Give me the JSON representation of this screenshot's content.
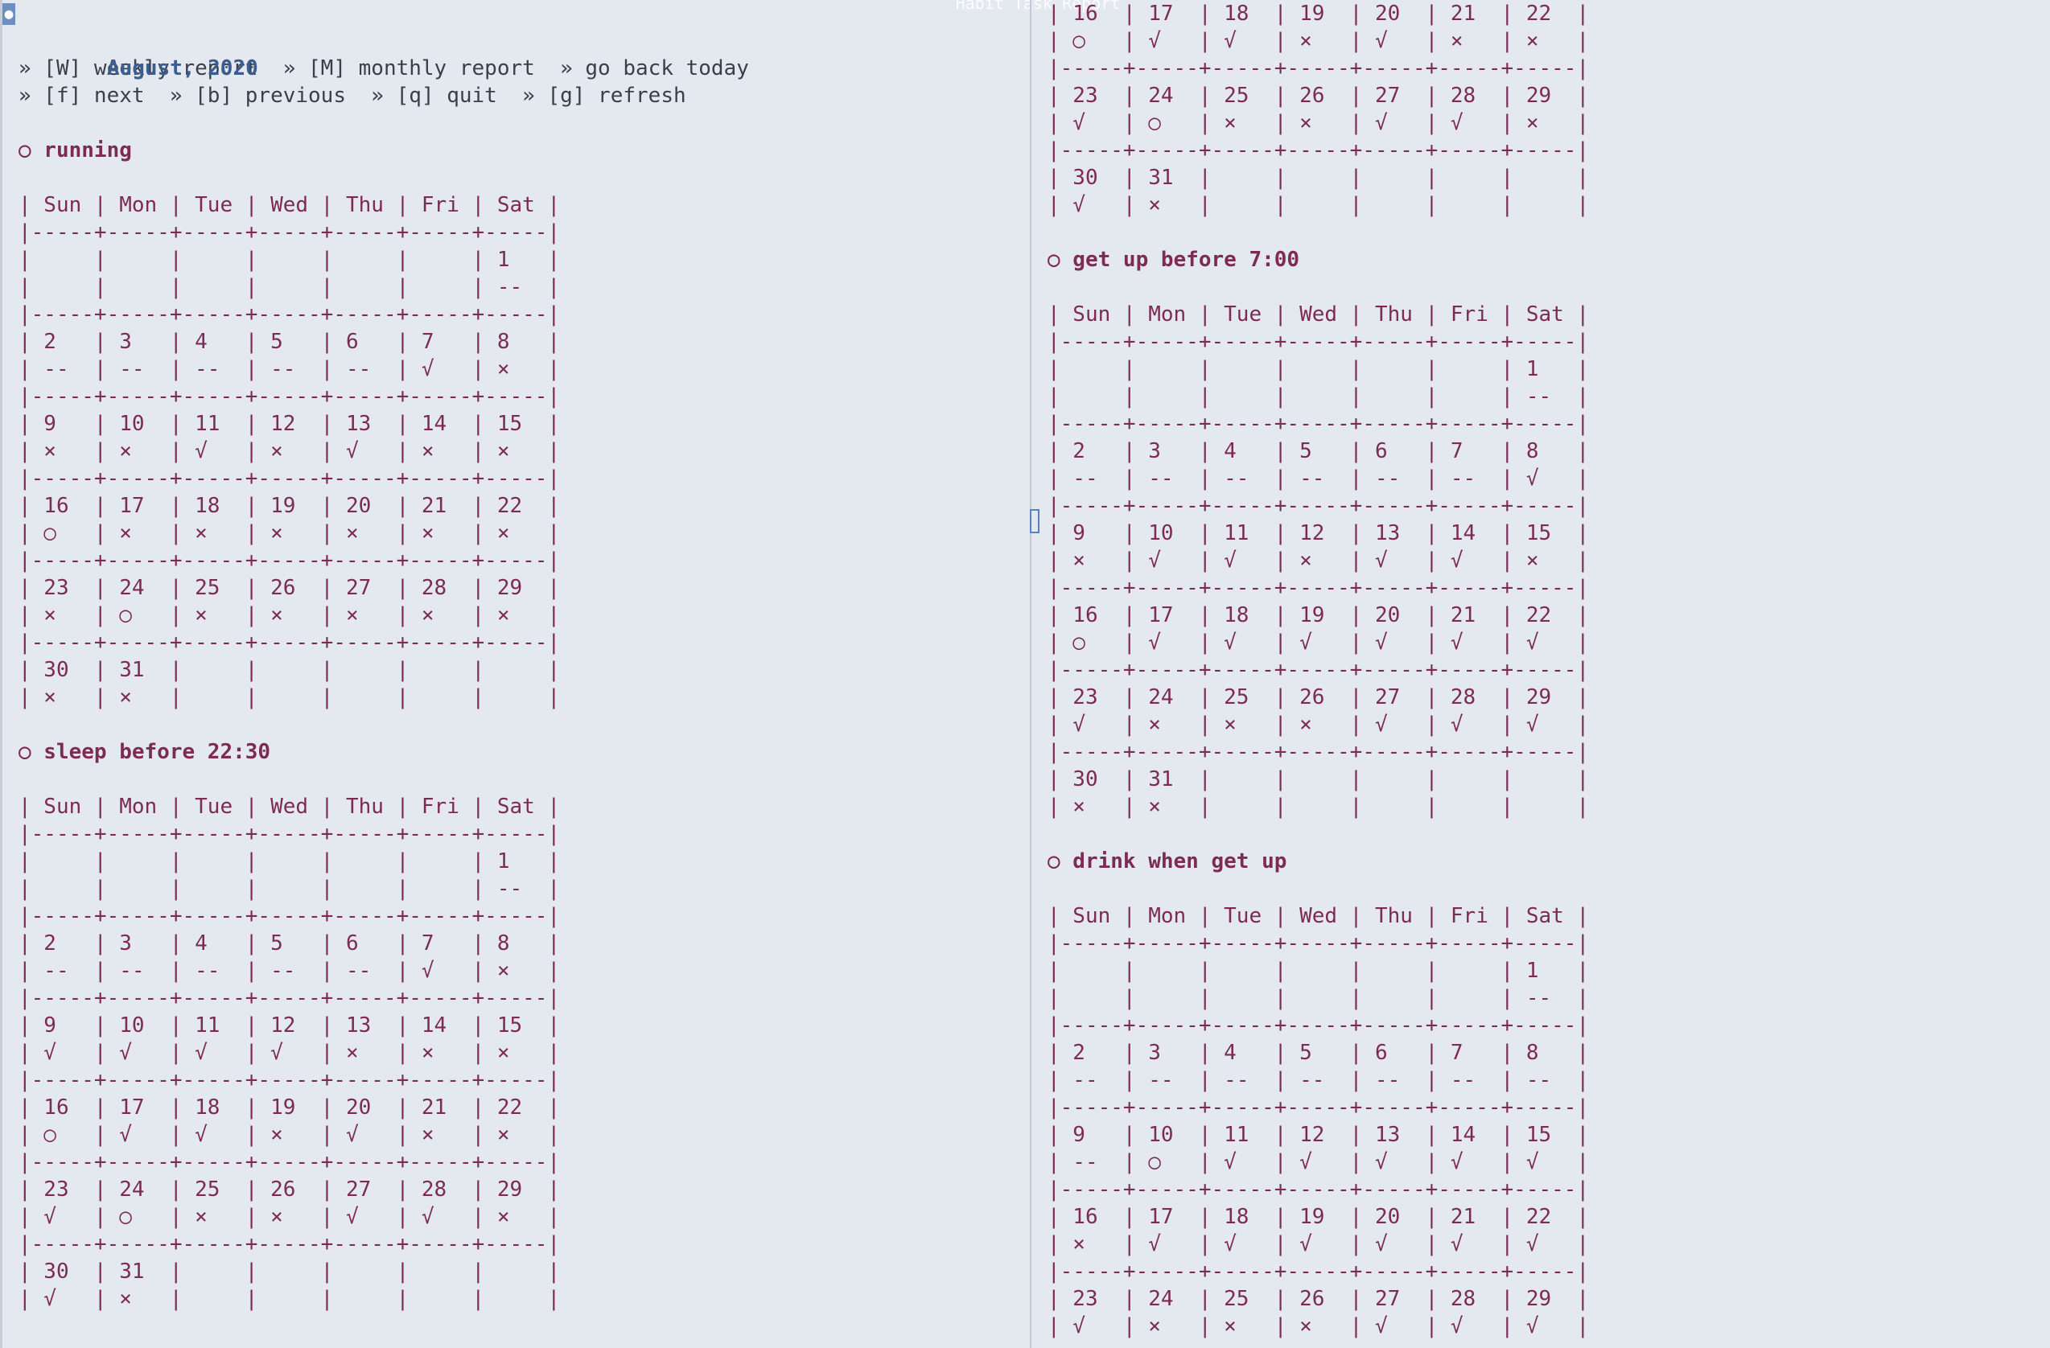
{
  "window_title": "Habit Task Report",
  "header": {
    "title": "August, 2020",
    "menu_line_1": "» [W] weekly report  » [M] monthly report  » go back today",
    "menu_line_2": "» [f] next  » [b] previous  » [q] quit  » [g] refresh"
  },
  "weekdays": [
    "Sun",
    "Mon",
    "Tue",
    "Wed",
    "Thu",
    "Fri",
    "Sat"
  ],
  "habits": [
    {
      "name": "○ running",
      "weeks": [
        [
          [
            "",
            ""
          ],
          [
            "",
            ""
          ],
          [
            "",
            ""
          ],
          [
            "",
            ""
          ],
          [
            "",
            ""
          ],
          [
            "",
            ""
          ],
          [
            "1",
            "--"
          ]
        ],
        [
          [
            "2",
            "--"
          ],
          [
            "3",
            "--"
          ],
          [
            "4",
            "--"
          ],
          [
            "5",
            "--"
          ],
          [
            "6",
            "--"
          ],
          [
            "7",
            "√"
          ],
          [
            "8",
            "×"
          ]
        ],
        [
          [
            "9",
            "×"
          ],
          [
            "10",
            "×"
          ],
          [
            "11",
            "√"
          ],
          [
            "12",
            "×"
          ],
          [
            "13",
            "√"
          ],
          [
            "14",
            "×"
          ],
          [
            "15",
            "×"
          ]
        ],
        [
          [
            "16",
            "○"
          ],
          [
            "17",
            "×"
          ],
          [
            "18",
            "×"
          ],
          [
            "19",
            "×"
          ],
          [
            "20",
            "×"
          ],
          [
            "21",
            "×"
          ],
          [
            "22",
            "×"
          ]
        ],
        [
          [
            "23",
            "×"
          ],
          [
            "24",
            "○"
          ],
          [
            "25",
            "×"
          ],
          [
            "26",
            "×"
          ],
          [
            "27",
            "×"
          ],
          [
            "28",
            "×"
          ],
          [
            "29",
            "×"
          ]
        ],
        [
          [
            "30",
            "×"
          ],
          [
            "31",
            "×"
          ],
          [
            "",
            ""
          ],
          [
            "",
            ""
          ],
          [
            "",
            ""
          ],
          [
            "",
            ""
          ],
          [
            "",
            ""
          ]
        ]
      ]
    },
    {
      "name": "○ sleep before 22:30",
      "weeks": [
        [
          [
            "",
            ""
          ],
          [
            "",
            ""
          ],
          [
            "",
            ""
          ],
          [
            "",
            ""
          ],
          [
            "",
            ""
          ],
          [
            "",
            ""
          ],
          [
            "1",
            "--"
          ]
        ],
        [
          [
            "2",
            "--"
          ],
          [
            "3",
            "--"
          ],
          [
            "4",
            "--"
          ],
          [
            "5",
            "--"
          ],
          [
            "6",
            "--"
          ],
          [
            "7",
            "√"
          ],
          [
            "8",
            "×"
          ]
        ],
        [
          [
            "9",
            "√"
          ],
          [
            "10",
            "√"
          ],
          [
            "11",
            "√"
          ],
          [
            "12",
            "√"
          ],
          [
            "13",
            "×"
          ],
          [
            "14",
            "×"
          ],
          [
            "15",
            "×"
          ]
        ],
        [
          [
            "16",
            "○"
          ],
          [
            "17",
            "√"
          ],
          [
            "18",
            "√"
          ],
          [
            "19",
            "×"
          ],
          [
            "20",
            "√"
          ],
          [
            "21",
            "×"
          ],
          [
            "22",
            "×"
          ]
        ],
        [
          [
            "23",
            "√"
          ],
          [
            "24",
            "○"
          ],
          [
            "25",
            "×"
          ],
          [
            "26",
            "×"
          ],
          [
            "27",
            "√"
          ],
          [
            "28",
            "√"
          ],
          [
            "29",
            "×"
          ]
        ],
        [
          [
            "30",
            "√"
          ],
          [
            "31",
            "×"
          ],
          [
            "",
            ""
          ],
          [
            "",
            ""
          ],
          [
            "",
            ""
          ],
          [
            "",
            ""
          ],
          [
            "",
            ""
          ]
        ]
      ]
    },
    {
      "name": "○ get up before 7:00",
      "weeks": [
        [
          [
            "",
            ""
          ],
          [
            "",
            ""
          ],
          [
            "",
            ""
          ],
          [
            "",
            ""
          ],
          [
            "",
            ""
          ],
          [
            "",
            ""
          ],
          [
            "1",
            "--"
          ]
        ],
        [
          [
            "2",
            "--"
          ],
          [
            "3",
            "--"
          ],
          [
            "4",
            "--"
          ],
          [
            "5",
            "--"
          ],
          [
            "6",
            "--"
          ],
          [
            "7",
            "--"
          ],
          [
            "8",
            "√"
          ]
        ],
        [
          [
            "9",
            "×"
          ],
          [
            "10",
            "√"
          ],
          [
            "11",
            "√"
          ],
          [
            "12",
            "×"
          ],
          [
            "13",
            "√"
          ],
          [
            "14",
            "√"
          ],
          [
            "15",
            "×"
          ]
        ],
        [
          [
            "16",
            "○"
          ],
          [
            "17",
            "√"
          ],
          [
            "18",
            "√"
          ],
          [
            "19",
            "√"
          ],
          [
            "20",
            "√"
          ],
          [
            "21",
            "√"
          ],
          [
            "22",
            "√"
          ]
        ],
        [
          [
            "23",
            "√"
          ],
          [
            "24",
            "×"
          ],
          [
            "25",
            "×"
          ],
          [
            "26",
            "×"
          ],
          [
            "27",
            "√"
          ],
          [
            "28",
            "√"
          ],
          [
            "29",
            "√"
          ]
        ],
        [
          [
            "30",
            "×"
          ],
          [
            "31",
            "×"
          ],
          [
            "",
            ""
          ],
          [
            "",
            ""
          ],
          [
            "",
            ""
          ],
          [
            "",
            ""
          ],
          [
            "",
            ""
          ]
        ]
      ]
    },
    {
      "name": "○ drink when get up",
      "weeks": [
        [
          [
            "",
            ""
          ],
          [
            "",
            ""
          ],
          [
            "",
            ""
          ],
          [
            "",
            ""
          ],
          [
            "",
            ""
          ],
          [
            "",
            ""
          ],
          [
            "1",
            "--"
          ]
        ],
        [
          [
            "2",
            "--"
          ],
          [
            "3",
            "--"
          ],
          [
            "4",
            "--"
          ],
          [
            "5",
            "--"
          ],
          [
            "6",
            "--"
          ],
          [
            "7",
            "--"
          ],
          [
            "8",
            "--"
          ]
        ],
        [
          [
            "9",
            "--"
          ],
          [
            "10",
            "○"
          ],
          [
            "11",
            "√"
          ],
          [
            "12",
            "√"
          ],
          [
            "13",
            "√"
          ],
          [
            "14",
            "√"
          ],
          [
            "15",
            "√"
          ]
        ],
        [
          [
            "16",
            "×"
          ],
          [
            "17",
            "√"
          ],
          [
            "18",
            "√"
          ],
          [
            "19",
            "√"
          ],
          [
            "20",
            "√"
          ],
          [
            "21",
            "√"
          ],
          [
            "22",
            "√"
          ]
        ],
        [
          [
            "23",
            "√"
          ],
          [
            "24",
            "×"
          ],
          [
            "25",
            "×"
          ],
          [
            "26",
            "×"
          ],
          [
            "27",
            "√"
          ],
          [
            "28",
            "√"
          ],
          [
            "29",
            "√"
          ]
        ]
      ]
    }
  ],
  "right_pane_top_weeks": [
    [
      [
        "16",
        "○"
      ],
      [
        "17",
        "√"
      ],
      [
        "18",
        "√"
      ],
      [
        "19",
        "×"
      ],
      [
        "20",
        "√"
      ],
      [
        "21",
        "×"
      ],
      [
        "22",
        "×"
      ]
    ],
    [
      [
        "23",
        "√"
      ],
      [
        "24",
        "○"
      ],
      [
        "25",
        "×"
      ],
      [
        "26",
        "×"
      ],
      [
        "27",
        "√"
      ],
      [
        "28",
        "√"
      ],
      [
        "29",
        "×"
      ]
    ],
    [
      [
        "30",
        "√"
      ],
      [
        "31",
        "×"
      ],
      [
        "",
        ""
      ],
      [
        "",
        ""
      ],
      [
        "",
        ""
      ],
      [
        "",
        ""
      ],
      [
        "",
        ""
      ]
    ]
  ],
  "colors": {
    "background": "#e4e8ef",
    "text": "#7c2b55",
    "title": "#3c5d8f",
    "menu": "#3a3f4c"
  }
}
